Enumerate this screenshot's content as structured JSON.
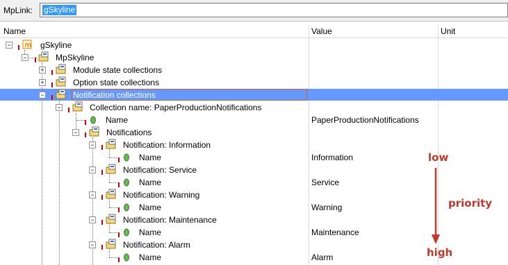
{
  "toolbar": {
    "label": "MpLink:",
    "value": "gSkyline"
  },
  "columns": {
    "name": "Name",
    "value": "Value",
    "unit": "Unit"
  },
  "tree": {
    "root": "gSkyline",
    "mp": "MpSkyline",
    "module_state": "Module state collections",
    "option_state": "Option state collections",
    "notification_collections": "Notification collections",
    "collection_name": "Collection name: PaperProductionNotifications",
    "name_label": "Name",
    "collection_value": "PaperProductionNotifications",
    "notifications": "Notifications",
    "items": [
      {
        "label": "Notification: Information",
        "name": "Name",
        "value": "Information"
      },
      {
        "label": "Notification: Service",
        "name": "Name",
        "value": "Service"
      },
      {
        "label": "Notification: Warning",
        "name": "Name",
        "value": "Warning"
      },
      {
        "label": "Notification: Maintenance",
        "name": "Name",
        "value": "Maintenance"
      },
      {
        "label": "Notification: Alarm",
        "name": "Name",
        "value": "Alarm"
      }
    ]
  },
  "annotation": {
    "low": "low",
    "priority": "priority",
    "high": "high",
    "color": "#c0392b"
  }
}
